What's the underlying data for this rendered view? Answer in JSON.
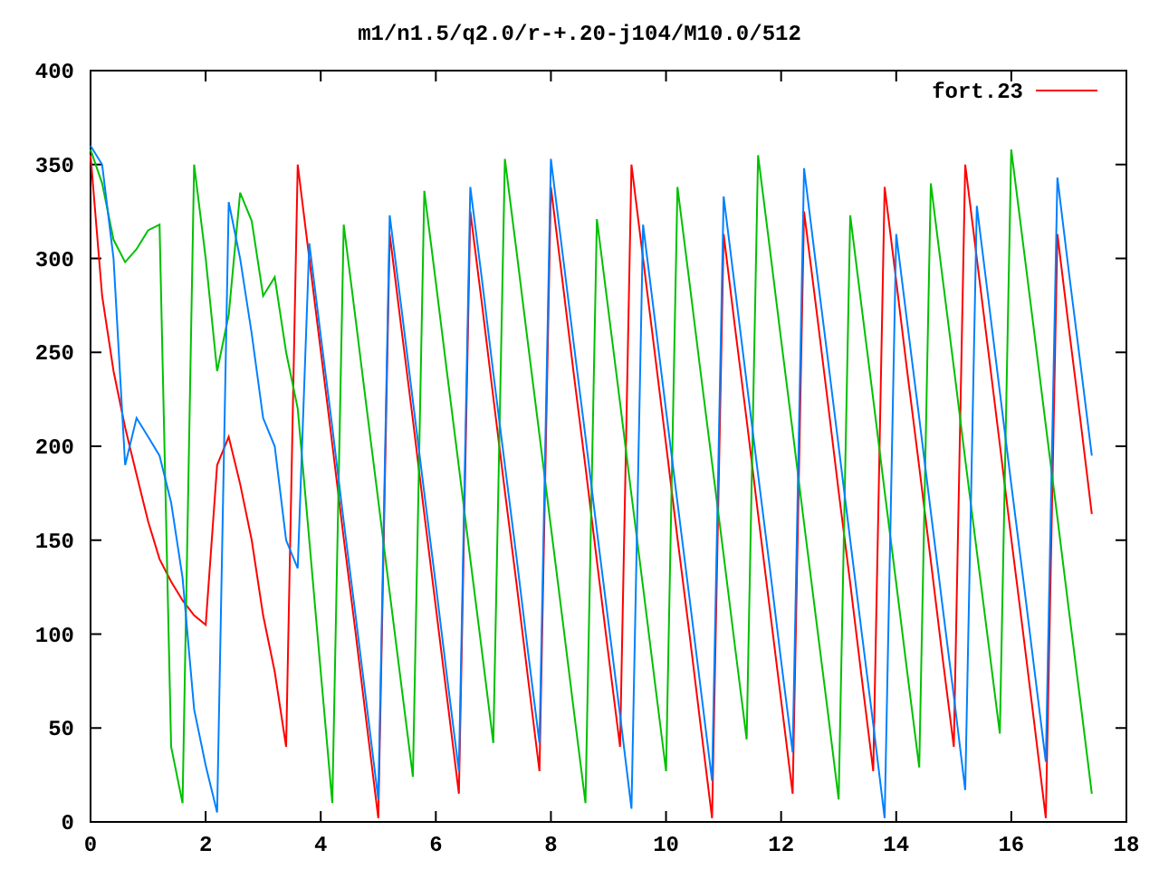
{
  "chart_data": {
    "type": "line",
    "title": "m1/n1.5/q2.0/r-+.20-j104/M10.0/512",
    "xlim": [
      0,
      18
    ],
    "ylim": [
      0,
      400
    ],
    "xticks": [
      0,
      2,
      4,
      6,
      8,
      10,
      12,
      14,
      16,
      18
    ],
    "yticks": [
      0,
      50,
      100,
      150,
      200,
      250,
      300,
      350,
      400
    ],
    "x": [
      0,
      0.2,
      0.4,
      0.6,
      0.8,
      1,
      1.2,
      1.4,
      1.6,
      1.8,
      2,
      2.2,
      2.4,
      2.6,
      2.8,
      3,
      3.2,
      3.4,
      3.6,
      3.8,
      4,
      4.2,
      4.4,
      4.6,
      4.8,
      5,
      5.2,
      5.4,
      5.6,
      5.8,
      6,
      6.2,
      6.4,
      6.6,
      6.8,
      7,
      7.2,
      7.4,
      7.6,
      7.8,
      8,
      8.2,
      8.4,
      8.6,
      8.8,
      9,
      9.2,
      9.4,
      9.6,
      9.8,
      10,
      10.2,
      10.4,
      10.6,
      10.8,
      11,
      11.2,
      11.4,
      11.6,
      11.8,
      12,
      12.2,
      12.4,
      12.6,
      12.8,
      13,
      13.2,
      13.4,
      13.6,
      13.8,
      14,
      14.2,
      14.4,
      14.6,
      14.8,
      15,
      15.2,
      15.4,
      15.6,
      15.8,
      16,
      16.2,
      16.4,
      16.6,
      16.8,
      17,
      17.2,
      17.4
    ],
    "series": [
      {
        "name": "fort.23",
        "color": "#ff0000",
        "values": [
          355,
          280,
          240,
          210,
          185,
          160,
          140,
          128,
          118,
          110,
          105,
          190,
          205,
          180,
          150,
          110,
          80,
          40,
          350,
          300,
          251,
          201,
          151,
          102,
          52,
          2,
          313,
          263,
          214,
          164,
          114,
          65,
          15,
          325,
          276,
          226,
          176,
          127,
          77,
          27,
          338,
          288,
          238,
          189,
          139,
          89,
          40,
          350,
          300,
          251,
          201,
          151,
          102,
          52,
          2,
          313,
          263,
          214,
          164,
          114,
          65,
          15,
          325,
          276,
          226,
          176,
          127,
          77,
          27,
          338,
          288,
          238,
          189,
          139,
          89,
          40,
          350,
          300,
          251,
          201,
          151,
          102,
          52,
          2,
          313,
          263,
          214,
          164
        ]
      },
      {
        "color": "#00c000",
        "values": [
          358,
          340,
          310,
          298,
          305,
          315,
          318,
          40,
          10,
          350,
          300,
          240,
          270,
          335,
          320,
          280,
          290,
          250,
          220,
          150,
          80,
          10,
          318,
          269,
          220,
          171,
          122,
          73,
          24,
          336,
          287,
          238,
          189,
          140,
          91,
          42,
          353,
          304,
          255,
          206,
          157,
          108,
          59,
          10,
          321,
          272,
          223,
          174,
          125,
          76,
          27,
          338,
          289,
          240,
          191,
          142,
          93,
          44,
          355,
          306,
          257,
          208,
          159,
          110,
          61,
          12,
          323,
          274,
          225,
          176,
          127,
          78,
          29,
          340,
          291,
          242,
          193,
          144,
          96,
          47,
          358,
          309,
          260,
          211,
          162,
          113,
          64,
          15
        ]
      },
      {
        "color": "#0080ff",
        "values": [
          360,
          350,
          300,
          190,
          215,
          205,
          195,
          170,
          130,
          60,
          30,
          5,
          330,
          300,
          260,
          215,
          200,
          150,
          135,
          308,
          259,
          210,
          160,
          111,
          62,
          12,
          323,
          274,
          224,
          175,
          126,
          76,
          27,
          338,
          289,
          239,
          190,
          141,
          91,
          42,
          353,
          303,
          254,
          205,
          155,
          106,
          57,
          7,
          318,
          269,
          219,
          170,
          121,
          72,
          22,
          333,
          284,
          234,
          185,
          136,
          86,
          37,
          348,
          298,
          249,
          200,
          150,
          101,
          52,
          2,
          313,
          264,
          215,
          165,
          116,
          67,
          17,
          328,
          279,
          229,
          180,
          131,
          81,
          32,
          343,
          293,
          244,
          195
        ]
      }
    ]
  }
}
